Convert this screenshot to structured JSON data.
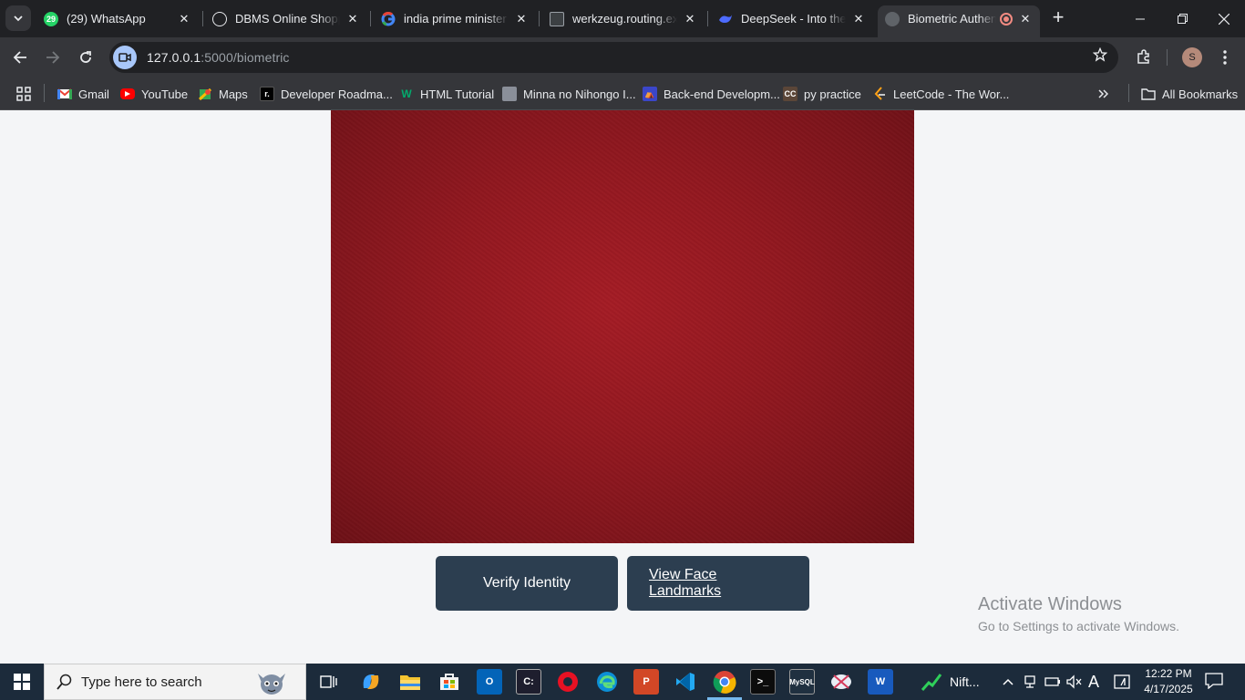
{
  "browser": {
    "tabs": [
      {
        "title": "(29) WhatsApp",
        "icon": "whatsapp-icon",
        "badge": "29",
        "color": "#25d366"
      },
      {
        "title": "DBMS Online Shopping",
        "icon": "openai-icon",
        "color": "#e8eaed"
      },
      {
        "title": "india prime minister -",
        "icon": "google-icon",
        "color": "#4285f4"
      },
      {
        "title": "werkzeug.routing.exc",
        "icon": "terminal-icon",
        "color": "#5f6368"
      },
      {
        "title": "DeepSeek - Into the Unknown",
        "icon": "deepseek-icon",
        "color": "#4d6bfe"
      },
      {
        "title": "Biometric Authentication",
        "icon": "globe-icon",
        "color": "#9aa0a6",
        "active": true
      }
    ],
    "url_host": "127.0.0.1",
    "url_path": ":5000/biometric",
    "profile_initial": "S",
    "bookmarks": [
      {
        "label": "Gmail",
        "icon": "gmail-icon"
      },
      {
        "label": "YouTube",
        "icon": "youtube-icon"
      },
      {
        "label": "Maps",
        "icon": "maps-icon"
      },
      {
        "label": "Developer Roadma...",
        "icon": "roadmap-icon"
      },
      {
        "label": "HTML Tutorial",
        "icon": "w3schools-icon"
      },
      {
        "label": "Minna no Nihongo I...",
        "icon": "image-icon"
      },
      {
        "label": "Back-end Developm...",
        "icon": "freecodecamp-icon"
      },
      {
        "label": "py practice",
        "icon": "codechef-icon"
      },
      {
        "label": "LeetCode - The Wor...",
        "icon": "leetcode-icon"
      }
    ],
    "all_bookmarks": "All Bookmarks"
  },
  "page": {
    "verify_button": "Verify Identity",
    "landmarks_link": "View Face Landmarks",
    "activate_title": "Activate Windows",
    "activate_subtitle": "Go to Settings to activate Windows."
  },
  "taskbar": {
    "search_placeholder": "Type here to search",
    "tray_app": "Nift...",
    "time": "12:22 PM",
    "date": "4/17/2025"
  }
}
